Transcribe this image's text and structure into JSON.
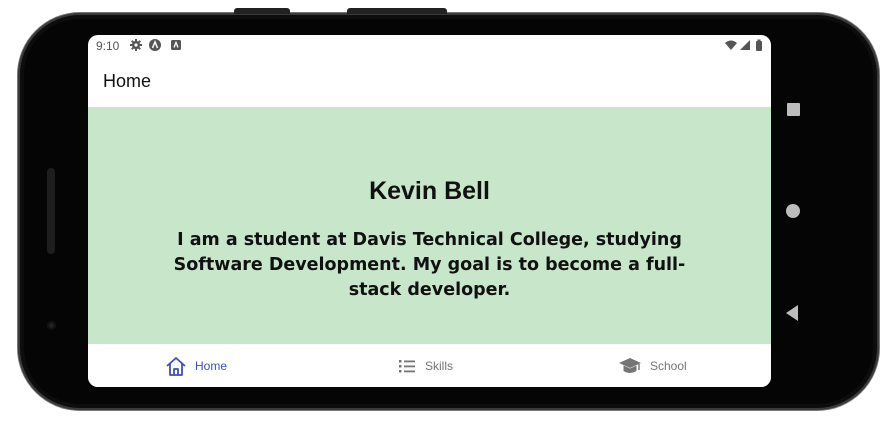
{
  "status_bar": {
    "time": "9:10",
    "icons": [
      "gear-icon",
      "a-icon",
      "app-icon",
      "wifi-icon",
      "signal-icon",
      "battery-icon"
    ]
  },
  "app_bar": {
    "title": "Home"
  },
  "profile": {
    "name": "Kevin Bell",
    "bio": "I am a student at Davis Technical College, studying Software Development. My goal is to become a full-stack developer."
  },
  "tabs": [
    {
      "label": "Home",
      "icon": "home-icon",
      "active": true
    },
    {
      "label": "Skills",
      "icon": "list-icon",
      "active": false
    },
    {
      "label": "School",
      "icon": "graduation-cap-icon",
      "active": false
    }
  ],
  "colors": {
    "content_bg": "#c8e6ca",
    "active_tab": "#3f51b5",
    "inactive_tab": "#757575"
  },
  "system_nav": [
    "recents-icon",
    "home-circle-icon",
    "back-icon"
  ]
}
